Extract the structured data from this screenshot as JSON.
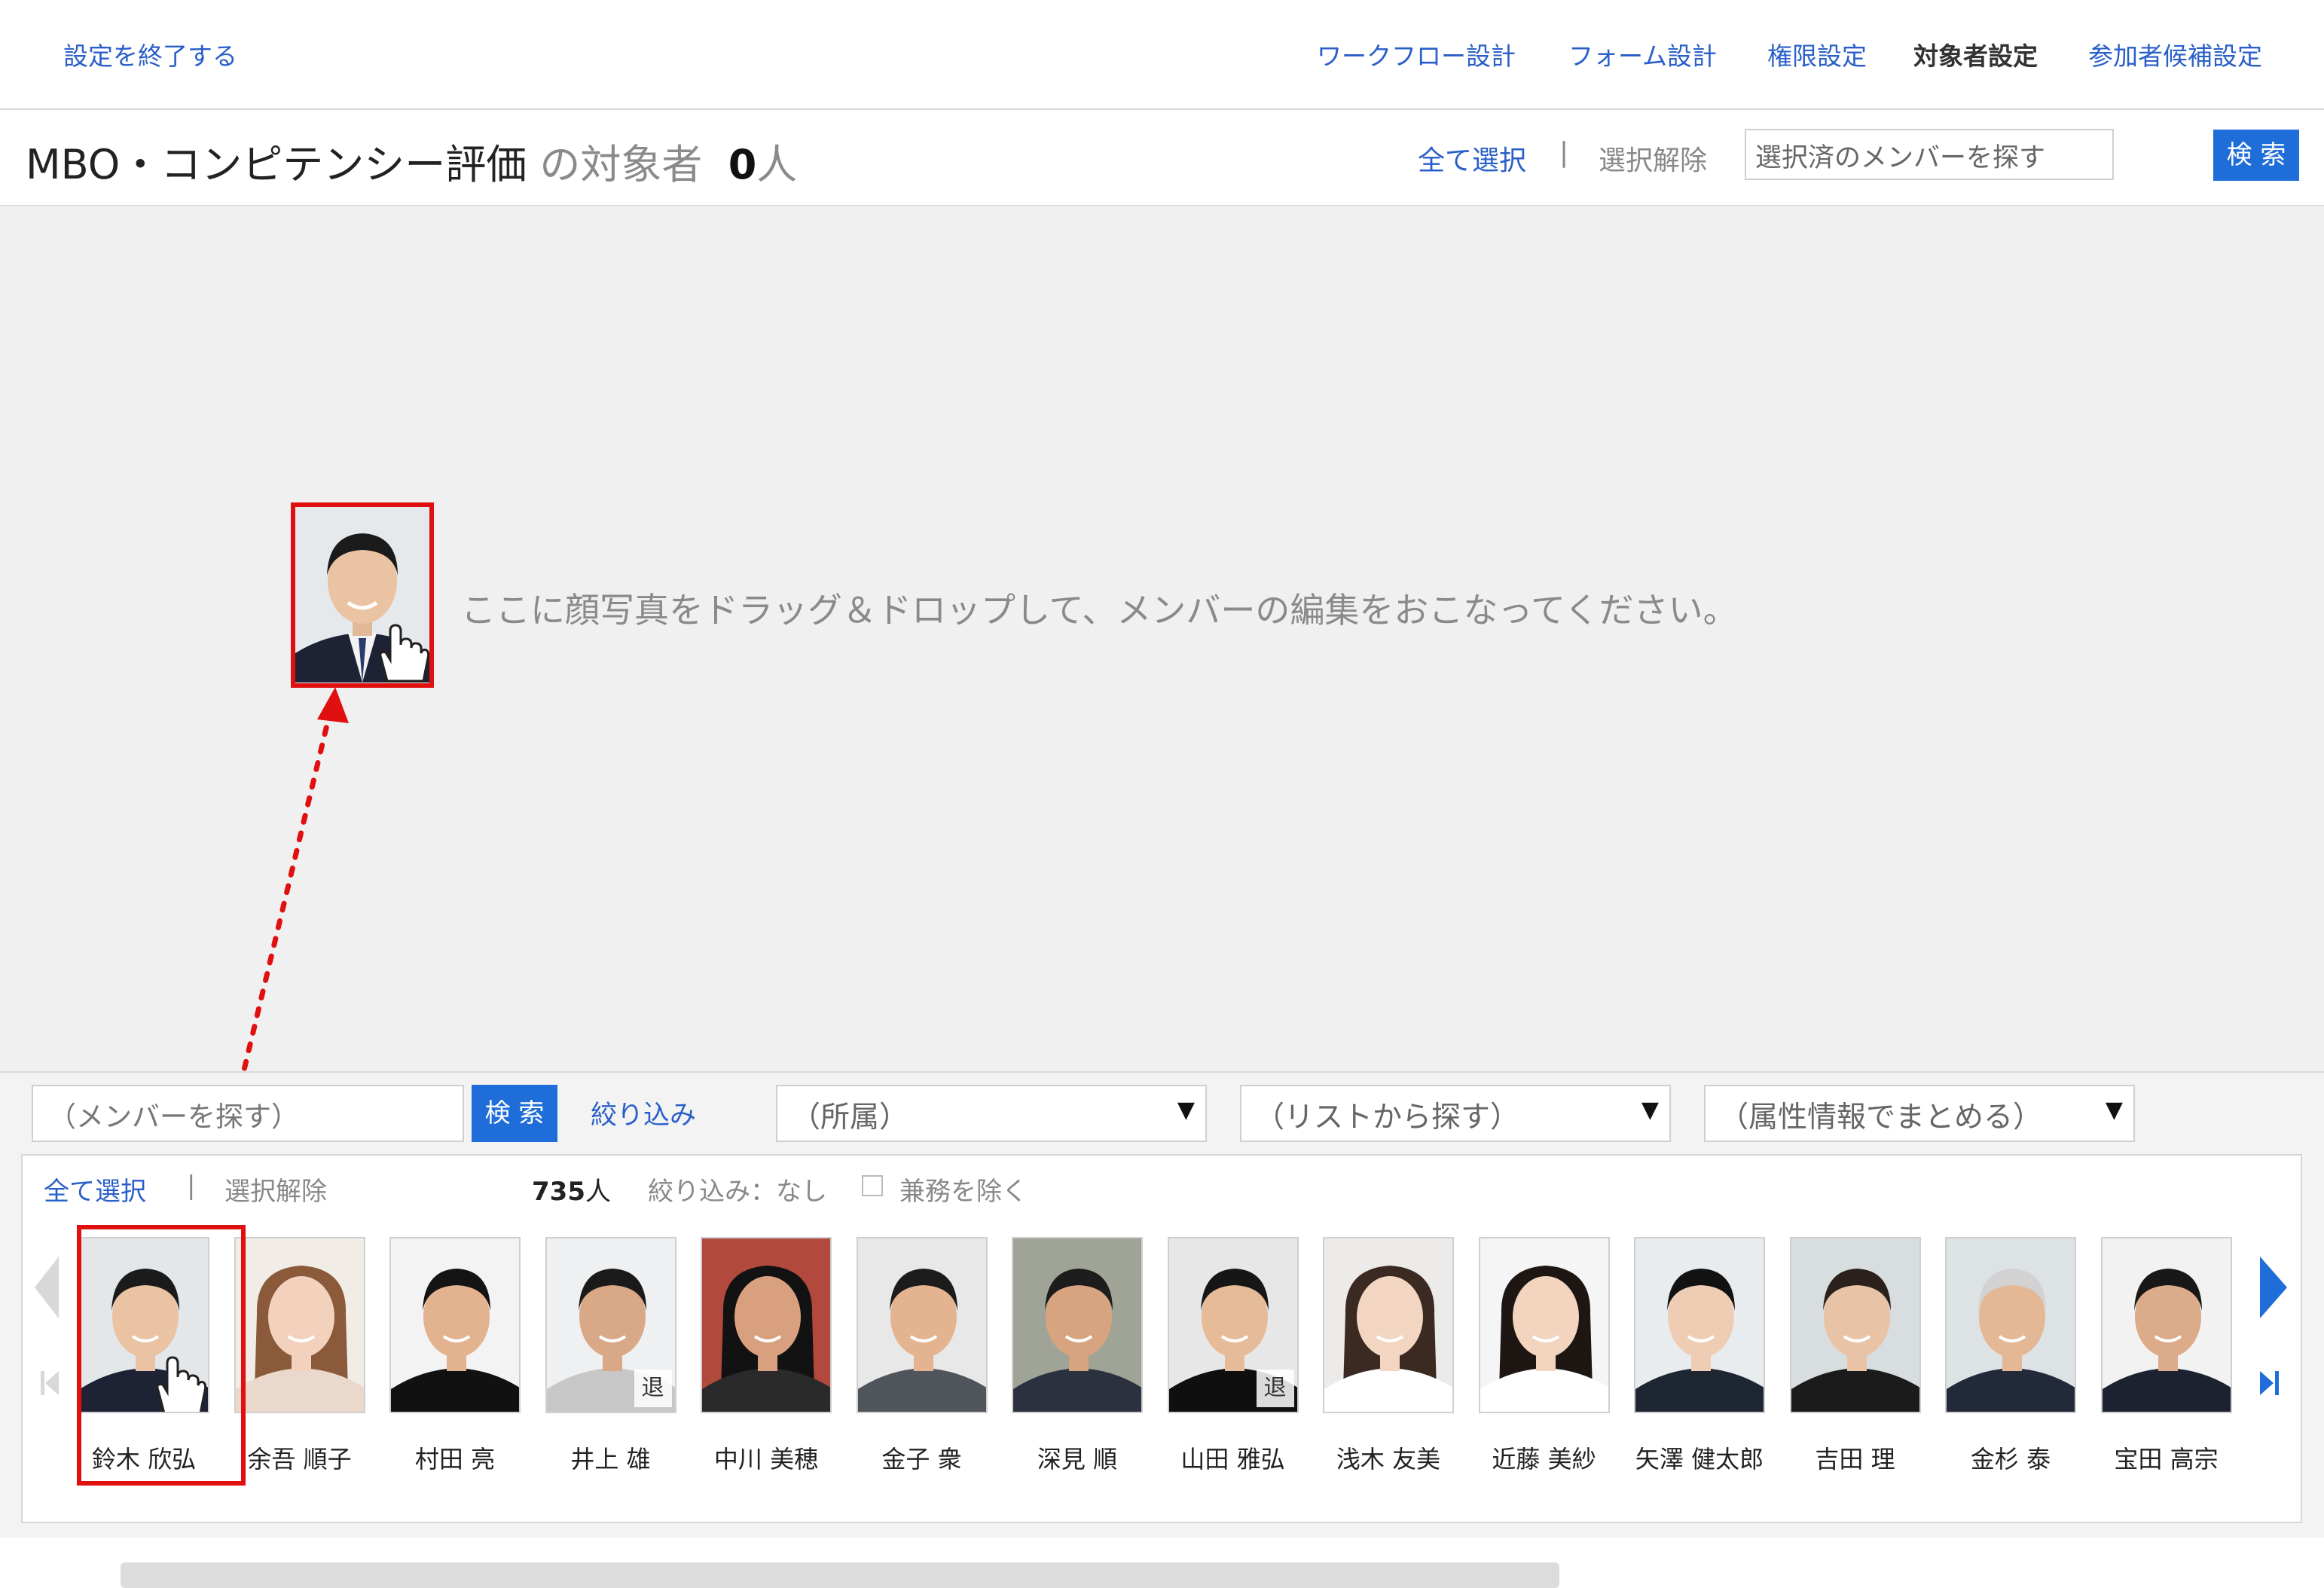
{
  "nav": {
    "exit_settings": "設定を終了する",
    "items": [
      {
        "label": "ワークフロー設計",
        "active": false
      },
      {
        "label": "フォーム設計",
        "active": false
      },
      {
        "label": "権限設定",
        "active": false
      },
      {
        "label": "対象者設定",
        "active": true
      },
      {
        "label": "参加者候補設定",
        "active": false
      }
    ]
  },
  "header": {
    "title": "MBO・コンピテンシー評価",
    "suffix": " の対象者",
    "count": "0",
    "unit": "人",
    "select_all": "全て選択",
    "separator": "|",
    "deselect": "選択解除",
    "search_placeholder": "選択済のメンバーを探す",
    "search_button": "検 索"
  },
  "dropzone": {
    "message": "ここに顔写真をドラッグ＆ドロップして、メンバーの編集をおこなってください。"
  },
  "panel": {
    "search_placeholder": "（メンバーを探す）",
    "search_button": "検 索",
    "filter_link": "絞り込み",
    "select_affiliation": "（所属）",
    "select_list": "（リストから探す）",
    "select_attribute": "（属性情報でまとめる）",
    "select_all": "全て選択",
    "separator": "|",
    "deselect": "選択解除",
    "total_count": "735",
    "total_unit": "人",
    "filter_status": "絞り込み：なし",
    "exclude_concurrent": "兼務を除く",
    "retired_badge": "退",
    "members": [
      {
        "name": "鈴木 欣弘",
        "retired": false
      },
      {
        "name": "余吾 順子",
        "retired": false
      },
      {
        "name": "村田 亮",
        "retired": false
      },
      {
        "name": "井上 雄",
        "retired": true
      },
      {
        "name": "中川 美穂",
        "retired": false
      },
      {
        "name": "金子 衆",
        "retired": false
      },
      {
        "name": "深見 順",
        "retired": false
      },
      {
        "name": "山田 雅弘",
        "retired": true
      },
      {
        "name": "浅木 友美",
        "retired": false
      },
      {
        "name": "近藤 美紗",
        "retired": false
      },
      {
        "name": "矢澤 健太郎",
        "retired": false
      },
      {
        "name": "吉田 理",
        "retired": false
      },
      {
        "name": "金杉 泰",
        "retired": false
      },
      {
        "name": "宝田 高宗",
        "retired": false
      }
    ]
  },
  "colors": {
    "link": "#2a5fc9",
    "button": "#1f6dd8",
    "highlight": "#e01010",
    "dropzone_bg": "#f0f0f0"
  }
}
